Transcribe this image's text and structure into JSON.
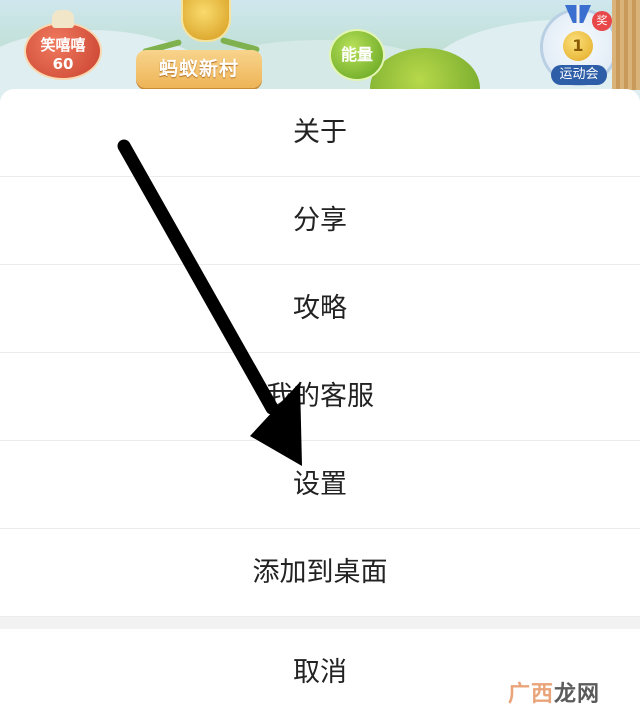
{
  "game_header": {
    "laugh_badge": {
      "label": "笑嘻嘻",
      "value": "60"
    },
    "village_title": "蚂蚁新村",
    "energy_label": "能量",
    "sports_meet": {
      "medal_number": "1",
      "prize_label": "奖",
      "label": "运动会"
    }
  },
  "menu": {
    "items": [
      {
        "label": "关于"
      },
      {
        "label": "分享"
      },
      {
        "label": "攻略"
      },
      {
        "label": "我的客服"
      },
      {
        "label": "设置"
      },
      {
        "label": "添加到桌面"
      }
    ],
    "cancel_label": "取消"
  },
  "annotation": {
    "icon": "arrow-down-pointer",
    "color": "#000000"
  },
  "watermark": {
    "part1": "广西",
    "part2": "龙网"
  }
}
